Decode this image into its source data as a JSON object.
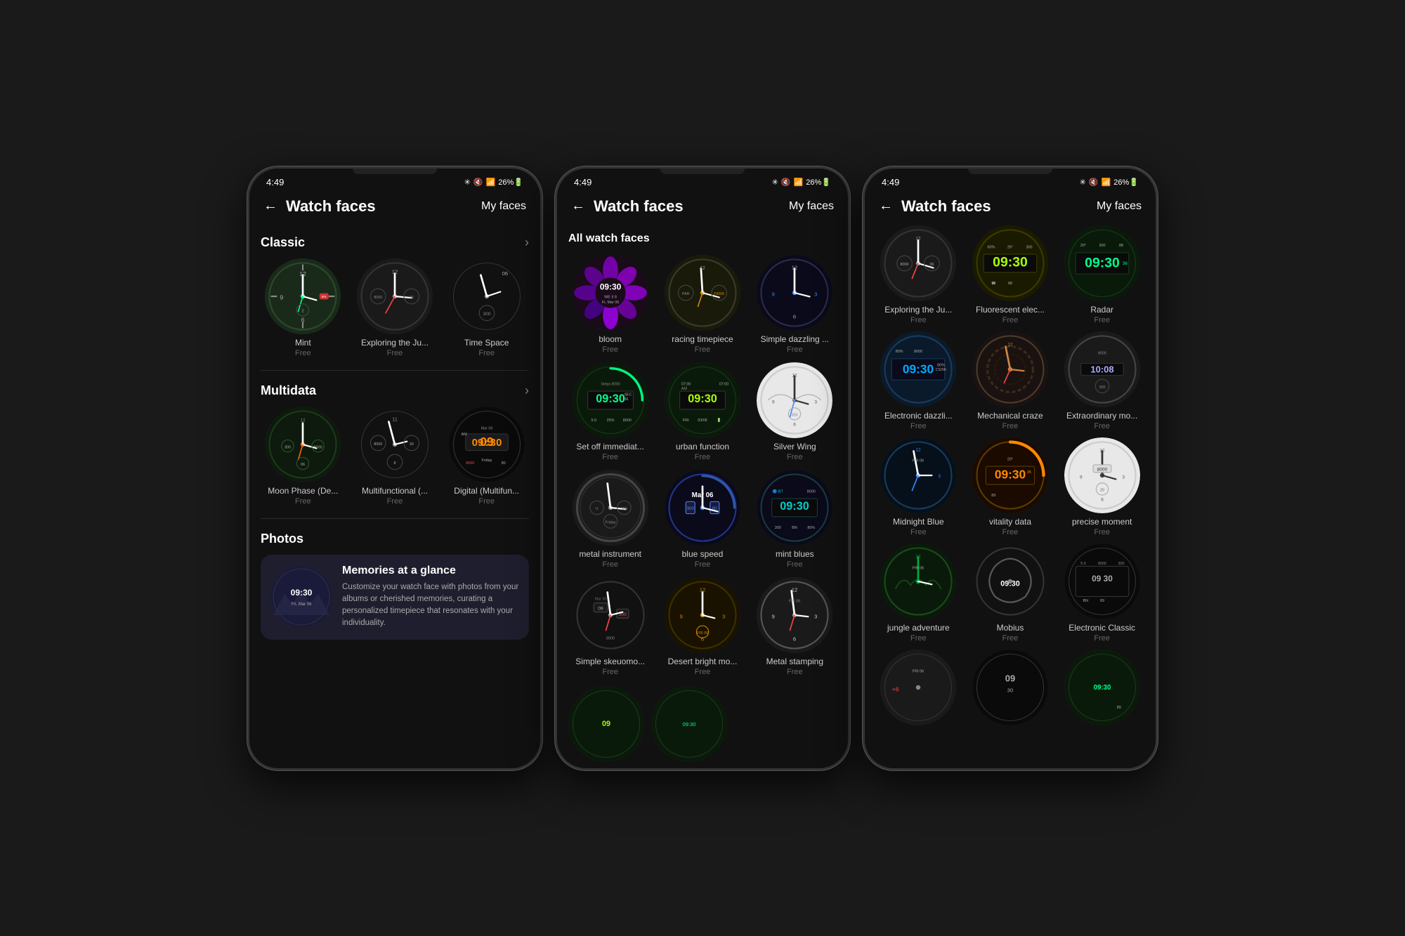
{
  "phones": [
    {
      "id": "phone1",
      "status": {
        "time": "4:49",
        "icons": "🔵 🔇 📶 26%🔋"
      },
      "header": {
        "back": "←",
        "title": "Watch faces",
        "action": "My faces"
      },
      "sections": [
        {
          "name": "Classic",
          "hasArrow": true,
          "items": [
            {
              "label": "Mint",
              "sublabel": "Free",
              "type": "mint"
            },
            {
              "label": "Exploring the Ju...",
              "sublabel": "Free",
              "type": "exploring"
            },
            {
              "label": "Time Space",
              "sublabel": "Free",
              "type": "timespace"
            }
          ]
        },
        {
          "name": "Multidata",
          "hasArrow": true,
          "items": [
            {
              "label": "Moon Phase (De...",
              "sublabel": "Free",
              "type": "moonphase"
            },
            {
              "label": "Multifunctional (...",
              "sublabel": "Free",
              "type": "multifunctional"
            },
            {
              "label": "Digital (Multifun...",
              "sublabel": "Free",
              "type": "digital"
            }
          ]
        },
        {
          "name": "Photos",
          "hasArrow": false,
          "photos": {
            "title": "Memories at a glance",
            "desc": "Customize your watch face with photos from your albums or cherished memories, curating a personalized timepiece that resonates with your individuality.",
            "time": "09:30\nFri, Mar 06"
          }
        }
      ]
    },
    {
      "id": "phone2",
      "status": {
        "time": "4:49",
        "icons": "🔵 🔇 📶 26%🔋"
      },
      "header": {
        "back": "←",
        "title": "Watch faces",
        "action": "My faces"
      },
      "sectionTitle": "All watch faces",
      "items": [
        {
          "label": "bloom",
          "sublabel": "Free",
          "type": "bloom"
        },
        {
          "label": "racing timepiece",
          "sublabel": "Free",
          "type": "racing"
        },
        {
          "label": "Simple dazzling ...",
          "sublabel": "Free",
          "type": "simpledazzling"
        },
        {
          "label": "Set off immediat...",
          "sublabel": "Free",
          "type": "setoff"
        },
        {
          "label": "urban function",
          "sublabel": "Free",
          "type": "urban"
        },
        {
          "label": "Silver Wing",
          "sublabel": "Free",
          "type": "silverwing"
        },
        {
          "label": "metal instrument",
          "sublabel": "Free",
          "type": "metalinstrument"
        },
        {
          "label": "blue speed",
          "sublabel": "Free",
          "type": "bluespeed"
        },
        {
          "label": "mint blues",
          "sublabel": "Free",
          "type": "mintblues"
        },
        {
          "label": "Simple skeuomo...",
          "sublabel": "Free",
          "type": "simpleskeuomo"
        },
        {
          "label": "Desert bright mo...",
          "sublabel": "Free",
          "type": "desert"
        },
        {
          "label": "Metal stamping",
          "sublabel": "Free",
          "type": "metalstamping"
        }
      ]
    },
    {
      "id": "phone3",
      "status": {
        "time": "4:49",
        "icons": "🔵 🔇 📶 26%🔋"
      },
      "header": {
        "back": "←",
        "title": "Watch faces",
        "action": "My faces"
      },
      "items": [
        {
          "label": "Exploring the Ju...",
          "sublabel": "Free",
          "type": "exploring2"
        },
        {
          "label": "Fluorescent elec...",
          "sublabel": "Free",
          "type": "fluorescentelec"
        },
        {
          "label": "Radar",
          "sublabel": "Free",
          "type": "radar"
        },
        {
          "label": "Electronic dazzli...",
          "sublabel": "Free",
          "type": "electronicdazzli"
        },
        {
          "label": "Mechanical craze",
          "sublabel": "Free",
          "type": "mechanicalcraze"
        },
        {
          "label": "Extraordinary mo...",
          "sublabel": "Free",
          "type": "extraordinarymo"
        },
        {
          "label": "Midnight Blue",
          "sublabel": "Free",
          "type": "midnightblue"
        },
        {
          "label": "vitality data",
          "sublabel": "Free",
          "type": "vitalitydata"
        },
        {
          "label": "precise moment",
          "sublabel": "Free",
          "type": "precisemoment"
        },
        {
          "label": "jungle adventure",
          "sublabel": "Free",
          "type": "jungleadventure"
        },
        {
          "label": "Mobius",
          "sublabel": "Free",
          "type": "mobius"
        },
        {
          "label": "Electronic Classic",
          "sublabel": "Free",
          "type": "electronicclassic"
        }
      ]
    }
  ]
}
